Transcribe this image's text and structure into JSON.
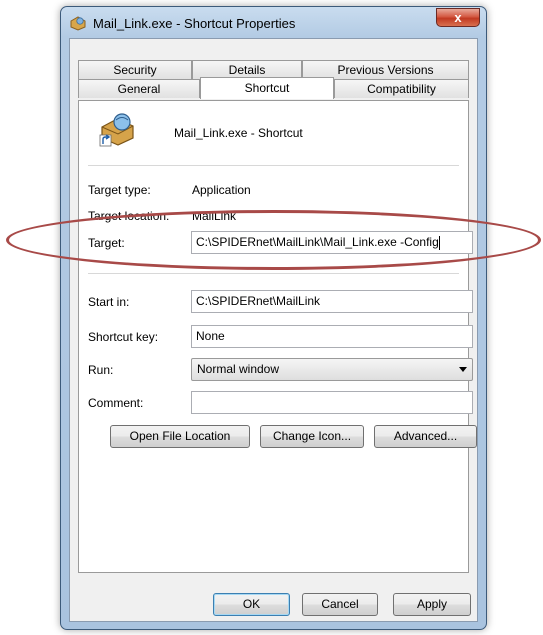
{
  "window": {
    "title": "Mail_Link.exe - Shortcut Properties",
    "close_glyph": "x"
  },
  "tabs": {
    "row1": [
      "Security",
      "Details",
      "Previous Versions"
    ],
    "row2": [
      "General",
      "Shortcut",
      "Compatibility"
    ],
    "active": "Shortcut"
  },
  "shortcut": {
    "name": "Mail_Link.exe - Shortcut",
    "target_type_label": "Target type:",
    "target_type_value": "Application",
    "target_location_label": "Target location:",
    "target_location_value": "MailLink",
    "target_label": "Target:",
    "target_value": "C:\\SPIDERnet\\MailLink\\Mail_Link.exe -Config",
    "start_in_label": "Start in:",
    "start_in_value": "C:\\SPIDERnet\\MailLink",
    "shortcut_key_label": "Shortcut key:",
    "shortcut_key_value": "None",
    "run_label": "Run:",
    "run_value": "Normal window",
    "comment_label": "Comment:",
    "comment_value": ""
  },
  "actions": {
    "open_file_location": "Open File Location",
    "change_icon": "Change Icon...",
    "advanced": "Advanced..."
  },
  "footer": {
    "ok": "OK",
    "cancel": "Cancel",
    "apply": "Apply"
  },
  "colors": {
    "highlight_ellipse": "#a84a48",
    "close_button": "#c13a22",
    "default_button_border": "#3c7fb1"
  }
}
